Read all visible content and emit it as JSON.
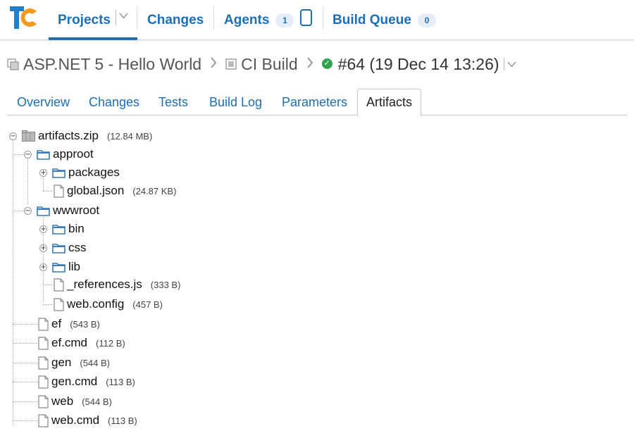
{
  "topnav": {
    "logo_text": "TC",
    "projects": "Projects",
    "changes": "Changes",
    "agents": "Agents",
    "agents_count": "1",
    "build_queue": "Build Queue",
    "build_queue_count": "0"
  },
  "breadcrumb": {
    "project": "ASP.NET 5 - Hello World",
    "build_config": "CI Build",
    "build": "#64 (19 Dec 14 13:26)",
    "status": "success"
  },
  "tabs": [
    "Overview",
    "Changes",
    "Tests",
    "Build Log",
    "Parameters",
    "Artifacts"
  ],
  "active_tab": "Artifacts",
  "tree": {
    "root": {
      "name": "artifacts.zip",
      "size": "(12.84 MB)"
    },
    "approot": {
      "name": "approot"
    },
    "packages": {
      "name": "packages"
    },
    "global_json": {
      "name": "global.json",
      "size": "(24.87 KB)"
    },
    "wwwroot": {
      "name": "wwwroot"
    },
    "bin": {
      "name": "bin"
    },
    "css": {
      "name": "css"
    },
    "lib": {
      "name": "lib"
    },
    "references_js": {
      "name": "_references.js",
      "size": "(333 B)"
    },
    "web_config": {
      "name": "web.config",
      "size": "(457 B)"
    },
    "ef": {
      "name": "ef",
      "size": "(543 B)"
    },
    "ef_cmd": {
      "name": "ef.cmd",
      "size": "(112 B)"
    },
    "gen": {
      "name": "gen",
      "size": "(544 B)"
    },
    "gen_cmd": {
      "name": "gen.cmd",
      "size": "(113 B)"
    },
    "web": {
      "name": "web",
      "size": "(544 B)"
    },
    "web_cmd": {
      "name": "web.cmd",
      "size": "(113 B)"
    }
  },
  "colors": {
    "link_blue": "#1f6eb3",
    "success_green": "#2ea44f",
    "folder_blue": "#3a7ab8"
  }
}
